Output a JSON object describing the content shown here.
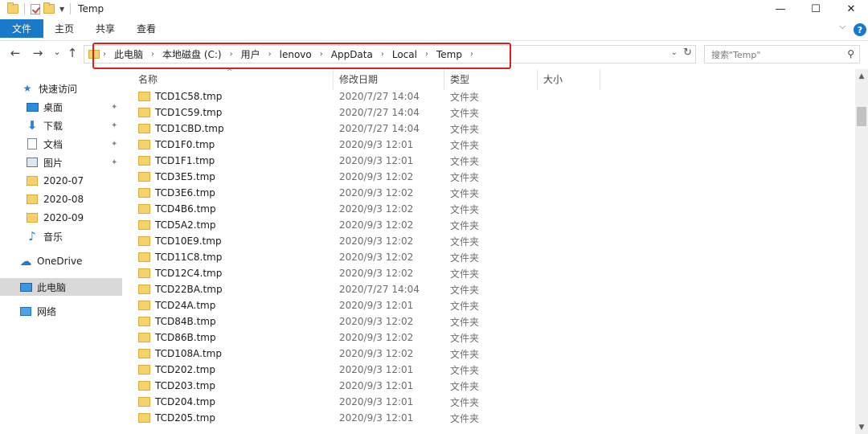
{
  "window": {
    "title": "Temp",
    "minimize_glyph": "—",
    "maximize_glyph": "☐",
    "close_glyph": "✕"
  },
  "ribbon": {
    "tabs": [
      "文件",
      "主页",
      "共享",
      "查看"
    ],
    "expand_glyph": "⌵",
    "help_glyph": "?"
  },
  "nav": {
    "back_glyph": "←",
    "forward_glyph": "→",
    "recent_glyph": "⌄",
    "up_glyph": "↑",
    "breadcrumb": [
      "此电脑",
      "本地磁盘 (C:)",
      "用户",
      "lenovo",
      "AppData",
      "Local",
      "Temp"
    ],
    "breadcrumb_sep": "›",
    "dropdown_glyph": "⌄",
    "refresh_glyph": "↻",
    "search_placeholder": "搜索\"Temp\"",
    "search_glyph": "⚲"
  },
  "sidebar": {
    "items": [
      {
        "label": "快速访问",
        "icon": "star-icon",
        "pinned": false
      },
      {
        "label": "桌面",
        "icon": "desktop-icon",
        "pinned": true
      },
      {
        "label": "下载",
        "icon": "download-icon",
        "pinned": true
      },
      {
        "label": "文档",
        "icon": "document-icon",
        "pinned": true
      },
      {
        "label": "图片",
        "icon": "picture-icon",
        "pinned": true
      },
      {
        "label": "2020-07",
        "icon": "folder-icon",
        "pinned": false
      },
      {
        "label": "2020-08",
        "icon": "folder-icon",
        "pinned": false
      },
      {
        "label": "2020-09",
        "icon": "folder-icon",
        "pinned": false
      },
      {
        "label": "音乐",
        "icon": "music-icon",
        "pinned": false
      },
      {
        "label": "OneDrive",
        "icon": "cloud-icon",
        "pinned": false
      },
      {
        "label": "此电脑",
        "icon": "computer-icon",
        "pinned": false,
        "selected": true
      },
      {
        "label": "网络",
        "icon": "network-icon",
        "pinned": false
      }
    ],
    "pin_glyph": "📌"
  },
  "columns": {
    "name": "名称",
    "date": "修改日期",
    "type": "类型",
    "size": "大小",
    "sort_glyph": "^"
  },
  "files": [
    {
      "name": "TCD1C58.tmp",
      "date": "2020/7/27 14:04",
      "type": "文件夹"
    },
    {
      "name": "TCD1C59.tmp",
      "date": "2020/7/27 14:04",
      "type": "文件夹"
    },
    {
      "name": "TCD1CBD.tmp",
      "date": "2020/7/27 14:04",
      "type": "文件夹"
    },
    {
      "name": "TCD1F0.tmp",
      "date": "2020/9/3 12:01",
      "type": "文件夹"
    },
    {
      "name": "TCD1F1.tmp",
      "date": "2020/9/3 12:01",
      "type": "文件夹"
    },
    {
      "name": "TCD3E5.tmp",
      "date": "2020/9/3 12:02",
      "type": "文件夹"
    },
    {
      "name": "TCD3E6.tmp",
      "date": "2020/9/3 12:02",
      "type": "文件夹"
    },
    {
      "name": "TCD4B6.tmp",
      "date": "2020/9/3 12:02",
      "type": "文件夹"
    },
    {
      "name": "TCD5A2.tmp",
      "date": "2020/9/3 12:02",
      "type": "文件夹"
    },
    {
      "name": "TCD10E9.tmp",
      "date": "2020/9/3 12:02",
      "type": "文件夹"
    },
    {
      "name": "TCD11C8.tmp",
      "date": "2020/9/3 12:02",
      "type": "文件夹"
    },
    {
      "name": "TCD12C4.tmp",
      "date": "2020/9/3 12:02",
      "type": "文件夹"
    },
    {
      "name": "TCD22BA.tmp",
      "date": "2020/7/27 14:04",
      "type": "文件夹"
    },
    {
      "name": "TCD24A.tmp",
      "date": "2020/9/3 12:01",
      "type": "文件夹"
    },
    {
      "name": "TCD84B.tmp",
      "date": "2020/9/3 12:02",
      "type": "文件夹"
    },
    {
      "name": "TCD86B.tmp",
      "date": "2020/9/3 12:02",
      "type": "文件夹"
    },
    {
      "name": "TCD108A.tmp",
      "date": "2020/9/3 12:02",
      "type": "文件夹"
    },
    {
      "name": "TCD202.tmp",
      "date": "2020/9/3 12:01",
      "type": "文件夹"
    },
    {
      "name": "TCD203.tmp",
      "date": "2020/9/3 12:01",
      "type": "文件夹"
    },
    {
      "name": "TCD204.tmp",
      "date": "2020/9/3 12:01",
      "type": "文件夹"
    },
    {
      "name": "TCD205.tmp",
      "date": "2020/9/3 12:01",
      "type": "文件夹"
    }
  ],
  "scrollbar": {
    "up_glyph": "▲",
    "down_glyph": "▼"
  },
  "colors": {
    "accent": "#1979ca",
    "folder": "#f5d36a",
    "highlight_box": "#d92020",
    "selected_bg": "#d9d9d9"
  }
}
